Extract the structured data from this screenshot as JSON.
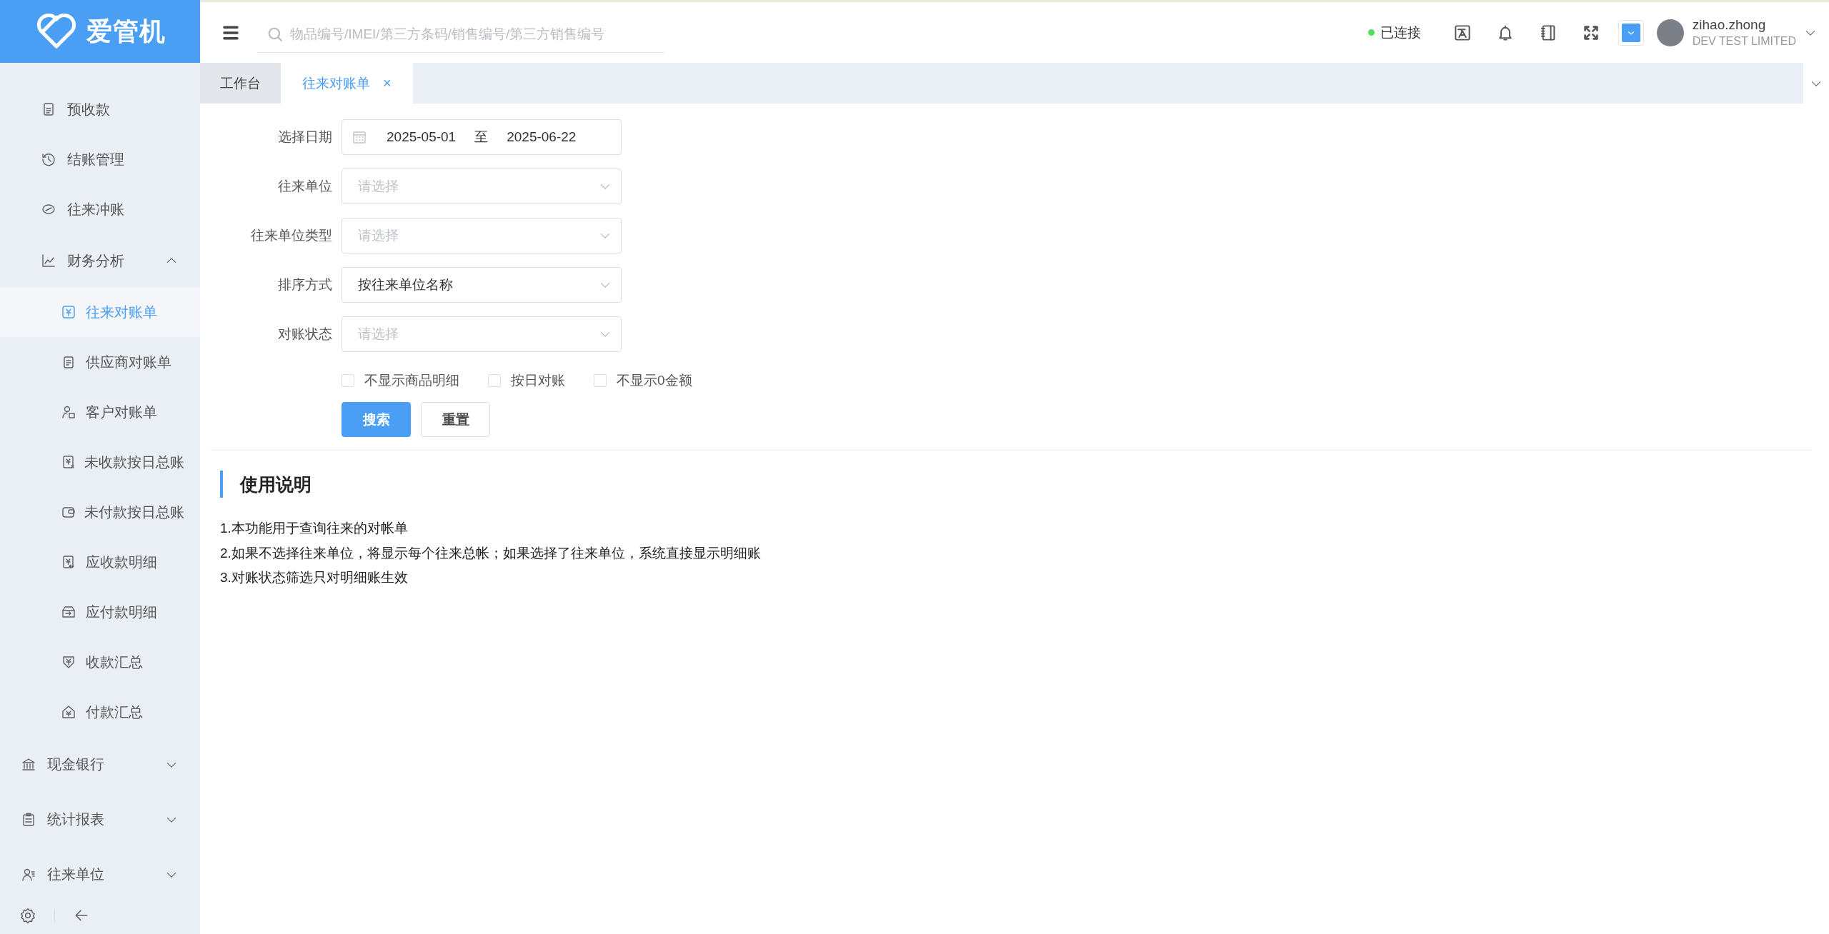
{
  "app": {
    "name": "爱管机"
  },
  "header": {
    "search": {
      "placeholder": "物品编号/IMEI/第三方条码/销售编号/第三方销售编号"
    },
    "connection": {
      "label": "已连接",
      "connected": true
    },
    "user": {
      "name": "zihao.zhong",
      "company": "DEV TEST LIMITED"
    }
  },
  "tabs": [
    {
      "label": "工作台",
      "selected": false
    },
    {
      "label": "往来对账单",
      "selected": true,
      "close": "×"
    }
  ],
  "sidebar": {
    "scrolled_group": [
      {
        "label": "预收款",
        "kind": "link"
      },
      {
        "label": "结账管理",
        "kind": "link"
      },
      {
        "label": "往来冲账",
        "kind": "link"
      },
      {
        "label": "财务分析",
        "kind": "group",
        "expanded": true,
        "children": [
          {
            "label": "往来对账单",
            "selected": true
          },
          {
            "label": "供应商对账单",
            "selected": false
          },
          {
            "label": "客户对账单",
            "selected": false
          },
          {
            "label": "未收款按日总账",
            "selected": false
          },
          {
            "label": "未付款按日总账",
            "selected": false
          },
          {
            "label": "应收款明细",
            "selected": false
          },
          {
            "label": "应付款明细",
            "selected": false
          },
          {
            "label": "收款汇总",
            "selected": false
          },
          {
            "label": "付款汇总",
            "selected": false
          }
        ]
      }
    ],
    "items": [
      {
        "label": "现金银行",
        "kind": "group",
        "expanded": false
      },
      {
        "label": "统计报表",
        "kind": "group",
        "expanded": false
      },
      {
        "label": "往来单位",
        "kind": "group",
        "expanded": false
      }
    ]
  },
  "form": {
    "fields": [
      {
        "label": "选择日期",
        "kind": "date_range",
        "start": "2025-05-01",
        "separator": "至",
        "end": "2025-06-22"
      },
      {
        "label": "往来单位",
        "kind": "select",
        "placeholder": "请选择"
      },
      {
        "label": "往来单位类型",
        "kind": "select",
        "placeholder": "请选择"
      },
      {
        "label": "排序方式",
        "kind": "select",
        "value": "按往来单位名称"
      },
      {
        "label": "对账状态",
        "kind": "select",
        "placeholder": "请选择"
      }
    ],
    "options": [
      {
        "label": "不显示商品明细",
        "checked": false
      },
      {
        "label": "按日对账",
        "checked": false
      },
      {
        "label": "不显示0金额",
        "checked": false
      }
    ],
    "buttons": [
      {
        "label": "搜索",
        "kind": "primary"
      },
      {
        "label": "重置",
        "kind": "default"
      }
    ]
  },
  "instructions": {
    "title": "使用说明",
    "lines": [
      "1.本功能用于查询往来的对帐单",
      "2.如果不选择往来单位，将显示每个往来总帐；如果选择了往来单位，系统直接显示明细账",
      "3.对账状态筛选只对明细账生效"
    ]
  }
}
